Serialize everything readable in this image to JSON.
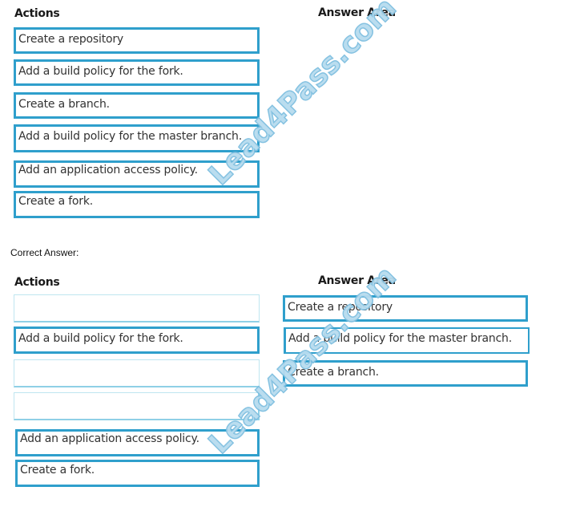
{
  "question": {
    "actions_heading": "Actions",
    "answer_heading": "Answer Area",
    "actions": [
      "Create a repository",
      "Add a build policy for the fork.",
      "Create a branch.",
      "Add a build policy for the master branch.",
      "Add an application access policy.",
      "Create a fork."
    ]
  },
  "correct_answer_label": "Correct Answer:",
  "answer": {
    "actions_heading": "Actions",
    "answer_heading": "Answer Area",
    "remaining_actions": [
      "",
      "Add a build policy for the fork.",
      "",
      "",
      "Add an application access policy.",
      "Create a fork."
    ],
    "answer_sequence": [
      "Create a repository",
      "Add a build policy for the master branch.",
      "Create a branch."
    ]
  },
  "watermark": "Lead4Pass.com",
  "colors": {
    "box_border": "#2f9fcc",
    "watermark": "#b7dcef"
  }
}
